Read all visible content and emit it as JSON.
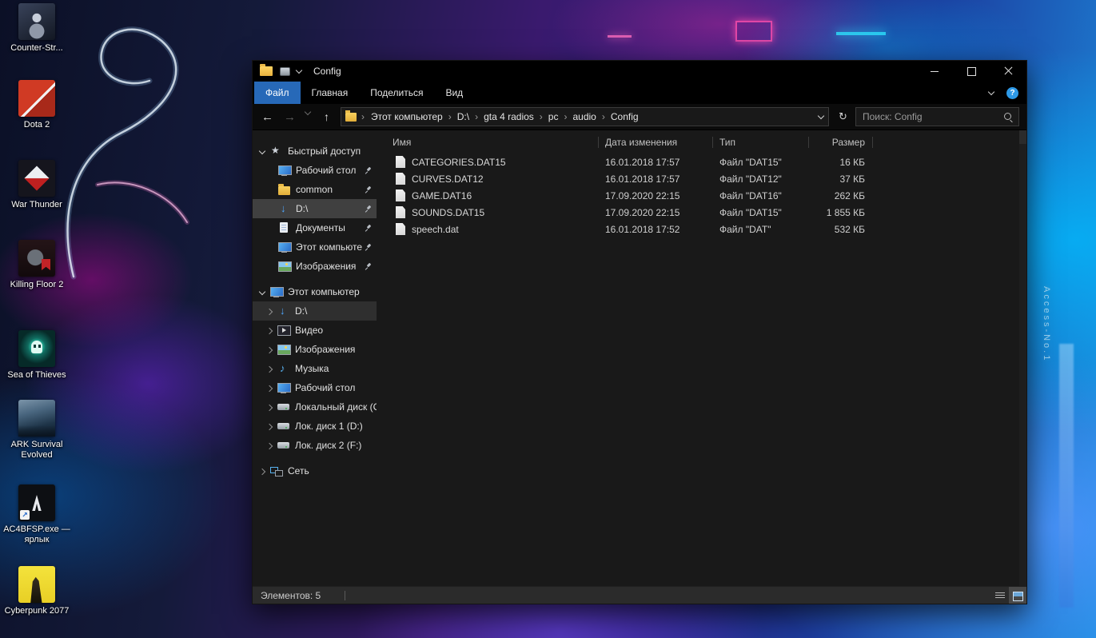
{
  "wallpaper": {
    "sign_text": "Access-No.1"
  },
  "desktop": {
    "icons": [
      {
        "label": "Counter-Str...",
        "icon": "cs"
      },
      {
        "label": "Dota 2",
        "icon": "dota"
      },
      {
        "label": "War Thunder",
        "icon": "wt"
      },
      {
        "label": "Killing Floor 2",
        "icon": "kf"
      },
      {
        "label": "Sea of Thieves",
        "icon": "sot"
      },
      {
        "label": "ARK Survival Evolved",
        "icon": "ark"
      },
      {
        "label": "AC4BFSP.exe — ярлык",
        "icon": "ac4",
        "shortcut": true
      },
      {
        "label": "Cyberpunk 2077",
        "icon": "cp"
      }
    ]
  },
  "window": {
    "title": "Config",
    "colors": {
      "accent": "#2769b8"
    },
    "tabs": [
      {
        "label": "Файл",
        "active": true
      },
      {
        "label": "Главная"
      },
      {
        "label": "Поделиться"
      },
      {
        "label": "Вид"
      }
    ],
    "breadcrumb": [
      "Этот компьютер",
      "D:\\",
      "gta 4 radios",
      "pc",
      "audio",
      "Config"
    ],
    "search": {
      "placeholder": "Поиск: Config"
    },
    "sidebar": {
      "items": [
        {
          "label": "Быстрый доступ",
          "icon": "ic-star",
          "level": "lv0",
          "chev": "chev-down"
        },
        {
          "label": "Рабочий стол",
          "icon": "ic-monitor",
          "level": "lv1",
          "chev": "chev-none",
          "pinned": true
        },
        {
          "label": "common",
          "icon": "ic-folder",
          "level": "lv1",
          "chev": "chev-none",
          "pinned": true
        },
        {
          "label": "D:\\",
          "icon": "ic-arrow",
          "level": "lv1",
          "chev": "chev-none",
          "pinned": true,
          "state": "selected"
        },
        {
          "label": "Документы",
          "icon": "ic-doc",
          "level": "lv1",
          "chev": "chev-none",
          "pinned": true
        },
        {
          "label": "Этот компьютер",
          "icon": "ic-monitor",
          "level": "lv1",
          "chev": "chev-none",
          "pinned": true
        },
        {
          "label": "Изображения",
          "icon": "ic-pictures",
          "level": "lv1",
          "chev": "chev-none",
          "pinned": true
        },
        {
          "label": "Этот компьютер",
          "icon": "ic-monitor",
          "level": "lv0",
          "chev": "chev-down",
          "gap": true
        },
        {
          "label": "D:\\",
          "icon": "ic-arrow",
          "level": "lv2",
          "chev": "chev-right",
          "state": "current"
        },
        {
          "label": "Видео",
          "icon": "ic-video",
          "level": "lv2",
          "chev": "chev-right"
        },
        {
          "label": "Изображения",
          "icon": "ic-pictures",
          "level": "lv2",
          "chev": "chev-right"
        },
        {
          "label": "Музыка",
          "icon": "ic-music",
          "level": "lv2",
          "chev": "chev-right"
        },
        {
          "label": "Рабочий стол",
          "icon": "ic-monitor",
          "level": "lv2",
          "chev": "chev-right"
        },
        {
          "label": "Локальный диск (C",
          "icon": "ic-disk",
          "level": "lv2",
          "chev": "chev-right"
        },
        {
          "label": "Лок. диск 1 (D:)",
          "icon": "ic-disk",
          "level": "lv2",
          "chev": "chev-right"
        },
        {
          "label": "Лок. диск 2 (F:)",
          "icon": "ic-disk",
          "level": "lv2",
          "chev": "chev-right"
        },
        {
          "label": "Сеть",
          "icon": "ic-network",
          "level": "lv0",
          "chev": "chev-right",
          "gap": true
        }
      ]
    },
    "files": {
      "columns": [
        "Имя",
        "Дата изменения",
        "Тип",
        "Размер"
      ],
      "rows": [
        {
          "name": "CATEGORIES.DAT15",
          "date": "16.01.2018 17:57",
          "type": "Файл \"DAT15\"",
          "size": "16 КБ"
        },
        {
          "name": "CURVES.DAT12",
          "date": "16.01.2018 17:57",
          "type": "Файл \"DAT12\"",
          "size": "37 КБ"
        },
        {
          "name": "GAME.DAT16",
          "date": "17.09.2020 22:15",
          "type": "Файл \"DAT16\"",
          "size": "262 КБ"
        },
        {
          "name": "SOUNDS.DAT15",
          "date": "17.09.2020 22:15",
          "type": "Файл \"DAT15\"",
          "size": "1 855 КБ"
        },
        {
          "name": "speech.dat",
          "date": "16.01.2018 17:52",
          "type": "Файл \"DAT\"",
          "size": "532 КБ"
        }
      ]
    },
    "status": {
      "items_count": "Элементов: 5"
    }
  }
}
